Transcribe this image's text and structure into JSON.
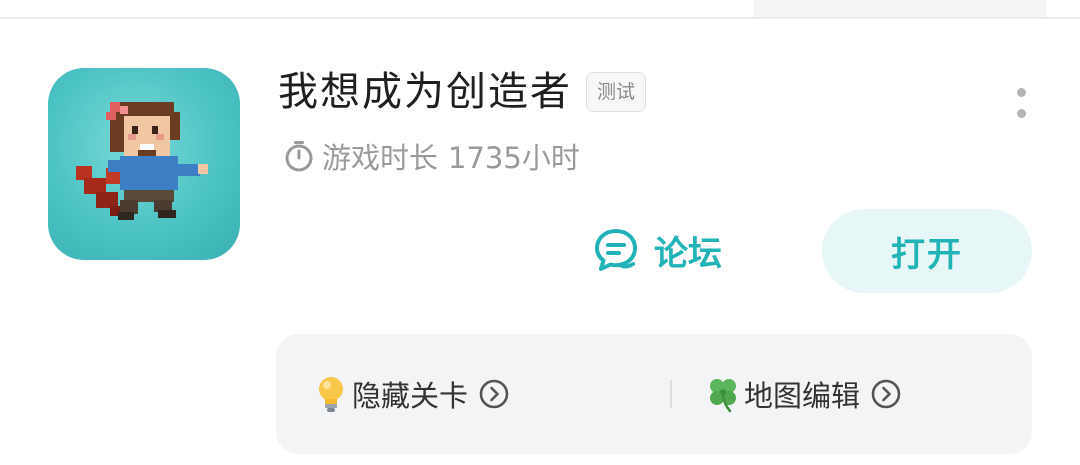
{
  "game": {
    "title": "我想成为创造者",
    "badge": "测试",
    "playtime_label": "游戏时长",
    "playtime_value": "1735小时",
    "icon": "pixel-hero-app-icon"
  },
  "actions": {
    "forum_label": "论坛",
    "open_label": "打开",
    "forum_icon": "chat-bubble-icon",
    "more_icon": "more-vertical-icon"
  },
  "features": [
    {
      "label": "隐藏关卡",
      "icon": "lightbulb-icon"
    },
    {
      "label": "地图编辑",
      "icon": "four-leaf-clover-icon"
    }
  ],
  "colors": {
    "accent": "#22b3b6",
    "open_button_bg": "#e7f7f7",
    "icon_bg": "#4cc3c4",
    "card_bg": "#f3f4f6"
  }
}
